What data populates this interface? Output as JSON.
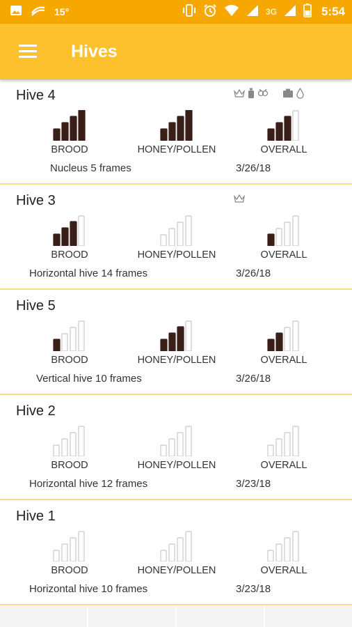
{
  "status_bar": {
    "temperature": "15°",
    "network": "3G",
    "time": "5:54",
    "icons": [
      "image-icon",
      "swipe-icon",
      "vibrate-icon",
      "alarm-icon",
      "wifi-icon",
      "cell-signal-icon",
      "cell-signal-icon",
      "battery-icon"
    ]
  },
  "app_bar": {
    "title": "Hives",
    "menu_icon": "hamburger-menu-icon",
    "background": "#fcc12c"
  },
  "colors": {
    "bar_filled": "#3a1f19",
    "bar_empty": "#c8c8c8",
    "divider": "#fbd98a",
    "status_bar": "#f7a800"
  },
  "metric_labels": {
    "brood": "BROOD",
    "honey": "HONEY/POLLEN",
    "overall": "OVERALL"
  },
  "hives": [
    {
      "name": "Hive 4",
      "icons": [
        "crown-icon",
        "medicine-bottle-icon",
        "pest-icon",
        "feeder-icon",
        "water-drop-icon"
      ],
      "brood_level": 4,
      "honey_level": 4,
      "overall_level": 3,
      "description": "Nucleus 5 frames",
      "date": "3/26/18"
    },
    {
      "name": "Hive 3",
      "icons": [
        "crown-icon"
      ],
      "brood_level": 3,
      "honey_level": 0,
      "overall_level": 1,
      "description": "Horizontal hive 14 frames",
      "date": "3/26/18"
    },
    {
      "name": "Hive 5",
      "icons": [],
      "brood_level": 1,
      "honey_level": 3,
      "overall_level": 2,
      "description": "Vertical hive 10 frames",
      "date": "3/26/18"
    },
    {
      "name": "Hive 2",
      "icons": [],
      "brood_level": 0,
      "honey_level": 0,
      "overall_level": 0,
      "description": "Horizontal hive 12 frames",
      "date": "3/23/18"
    },
    {
      "name": "Hive 1",
      "icons": [],
      "brood_level": 0,
      "honey_level": 0,
      "overall_level": 0,
      "description": "Horizontal hive 10 frames",
      "date": "3/23/18"
    }
  ]
}
